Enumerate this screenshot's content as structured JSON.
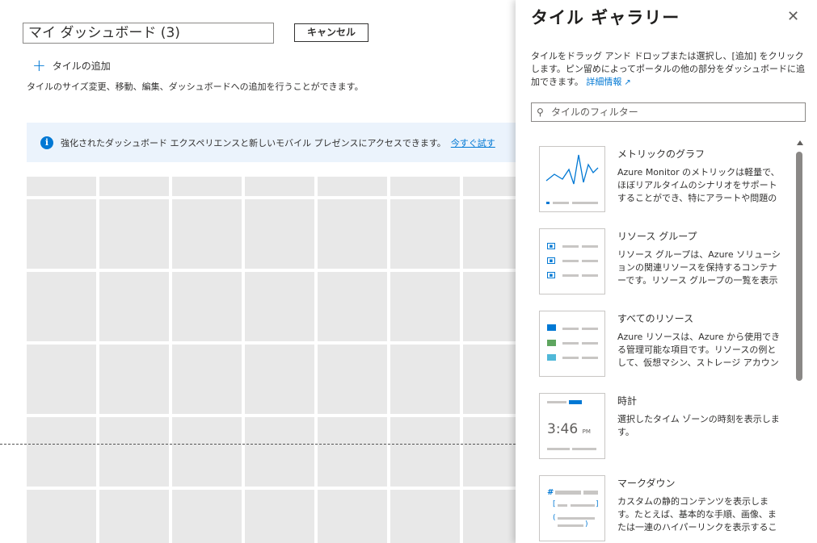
{
  "editor": {
    "dashboard_name": "マイ ダッシュボード (3)",
    "cancel_label": "キャンセル",
    "add_tile_label": "タイルの追加",
    "help_text": "タイルのサイズ変更、移動、編集、ダッシュボードへの追加を行うことができます。",
    "banner_text": "強化されたダッシュボード エクスペリエンスと新しいモバイル プレゼンスにアクセスできます。",
    "banner_link": "今すぐ試す"
  },
  "gallery": {
    "title": "タイル ギャラリー",
    "close_symbol": "✕",
    "description": "タイルをドラッグ アンド ドロップまたは選択し、[追加] をクリックします。ピン留めによってポータルの他の部分をダッシュボードに追加できます。",
    "more_info_link": "詳細情報",
    "filter_placeholder": "タイルのフィルター",
    "tiles": [
      {
        "name": "メトリックのグラフ",
        "icon": "line-chart-icon",
        "description": "Azure Monitor のメトリックは軽量で、ほぼリアルタイムのシナリオをサポートすることができ、特にアラートや問題の迅速な検出…"
      },
      {
        "name": "リソース グループ",
        "icon": "resource-group-icon",
        "description": "リソース グループは、Azure ソリューションの関連リソースを保持するコンテナーです。リソース グループの一覧を表示します。"
      },
      {
        "name": "すべてのリソース",
        "icon": "all-resources-icon",
        "description": "Azure リソースは、Azure から使用できる管理可能な項目です。リソースの例として、仮想マシン、ストレージ アカウント、Web…"
      },
      {
        "name": "時計",
        "icon": "clock-icon",
        "time": "3:46",
        "period": "PM",
        "description": "選択したタイム ゾーンの時刻を表示します。"
      },
      {
        "name": "マークダウン",
        "icon": "markdown-icon",
        "description": "カスタムの静的コンテンツを表示します。たとえば、基本的な手順、画像、または一連のハイパーリンクを表示することができます。"
      }
    ]
  },
  "colors": {
    "accent": "#0078d4",
    "banner_bg": "#ebf3fc",
    "grid_cell": "#e8e8e8"
  }
}
